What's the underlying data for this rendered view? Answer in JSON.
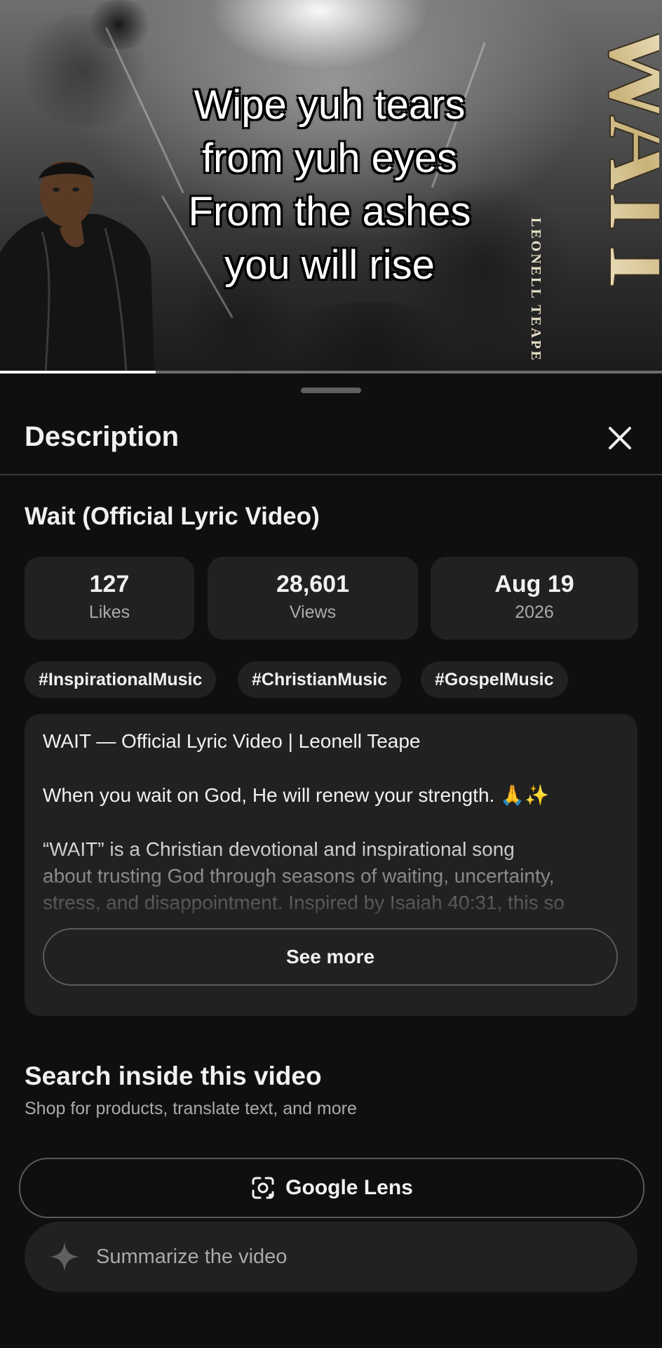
{
  "video": {
    "lyric_lines": [
      "Wipe yuh tears",
      "from yuh eyes",
      "From the ashes",
      "you will rise"
    ],
    "logo_text": "WAIT",
    "artist_overlay": "LEONELL TEAPE",
    "progress": 0.235
  },
  "sheet": {
    "title": "Description",
    "close_icon": "close-icon"
  },
  "video_title": "Wait (Official Lyric Video)",
  "stats": [
    {
      "value": "127",
      "label": "Likes"
    },
    {
      "value": "28,601",
      "label": "Views"
    },
    {
      "value": "Aug 19",
      "label": "2026"
    }
  ],
  "hashtags": [
    "#InspirationalMusic",
    "#ChristianMusic",
    "#GospelMusic"
  ],
  "description": {
    "line1": "WAIT — Official Lyric Video | Leonell Teape",
    "line2": "When you wait on God, He will renew your strength. 🙏✨",
    "line3": "“WAIT” is a Christian devotional and inspirational song",
    "line4": "about trusting God through seasons of waiting, uncertainty,",
    "line5": "stress, and disappointment. Inspired by Isaiah 40:31, this so",
    "see_more": "See more"
  },
  "search": {
    "title": "Search inside this video",
    "subtitle": "Shop for products, translate text, and more",
    "lens_label": "Google Lens",
    "summarize_label": "Summarize the video"
  }
}
